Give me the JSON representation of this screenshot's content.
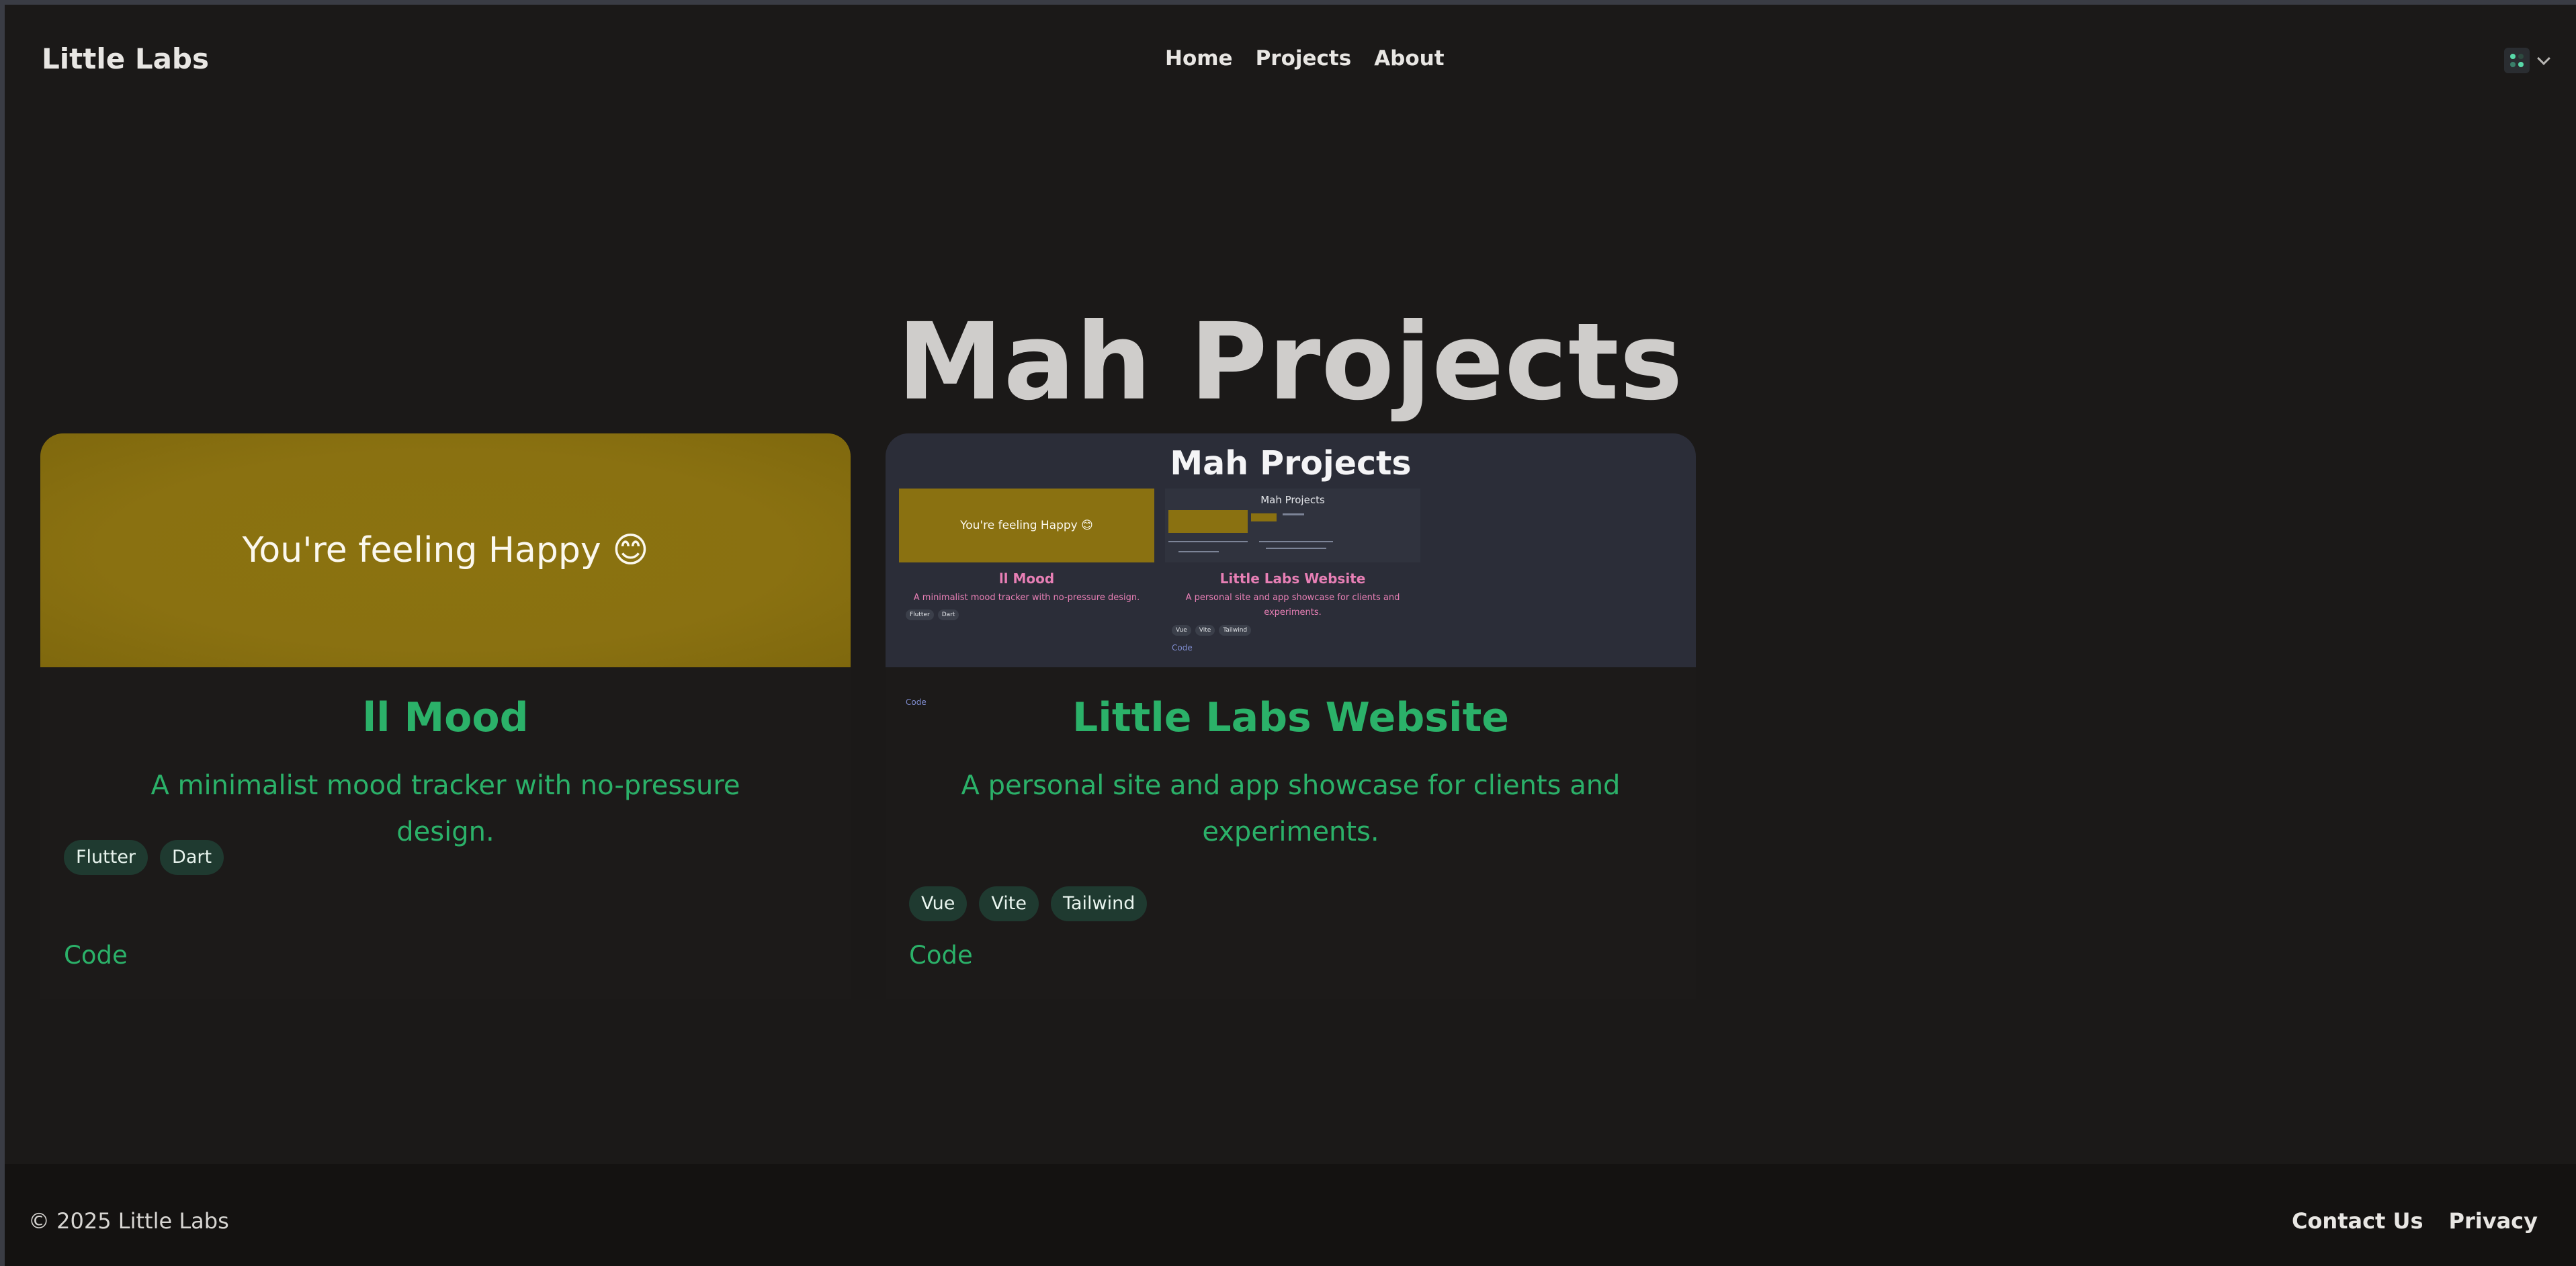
{
  "header": {
    "brand": "Little Labs",
    "nav": [
      "Home",
      "Projects",
      "About"
    ],
    "theme_icon": "palette-grid-icon"
  },
  "main": {
    "title": "Mah Projects",
    "projects": [
      {
        "image_text": "You're feeling Happy 😊",
        "title": "ll Mood",
        "description": "A minimalist mood tracker with no-pressure design.",
        "tags": [
          "Flutter",
          "Dart"
        ],
        "link": "Code"
      },
      {
        "image_preview": {
          "title": "Mah Projects",
          "cards": [
            {
              "image_text": "You're feeling Happy 😊",
              "title": "ll Mood",
              "description": "A minimalist mood tracker with no-pressure design.",
              "tags": [
                "Flutter",
                "Dart"
              ],
              "link": "Code"
            },
            {
              "inner_title": "Mah Projects",
              "title": "Little Labs Website",
              "description": "A personal site and app showcase for clients and experiments.",
              "tags": [
                "Vue",
                "Vite",
                "Tailwind"
              ],
              "link": "Code"
            }
          ]
        },
        "title": "Little Labs Website",
        "description": "A personal site and app showcase for clients and experiments.",
        "tags": [
          "Vue",
          "Vite",
          "Tailwind"
        ],
        "link": "Code"
      }
    ]
  },
  "footer": {
    "copyright": "© 2025 Little Labs",
    "links": [
      "Contact Us",
      "Privacy"
    ]
  },
  "colors": {
    "background": "#1b1918",
    "accent_green": "#2bb169",
    "mood_yellow": "#8a7111",
    "tag_bg": "#1f3a30",
    "preview_pink": "#e77fb5"
  }
}
